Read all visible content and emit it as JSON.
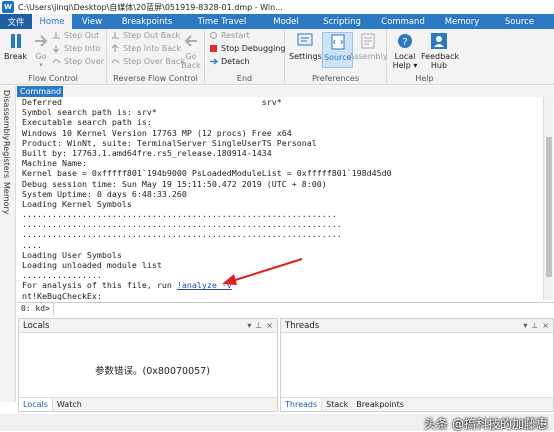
{
  "window": {
    "title": "C:\\Users\\jinqi\\Desktop\\自媒体\\20蓝屏\\051919-8328-01.dmp - Win..."
  },
  "ribbon": {
    "tabs": [
      "文件",
      "Home",
      "View",
      "Breakpoints",
      "Time Travel",
      "Model",
      "Scripting",
      "Command",
      "Memory",
      "Source"
    ],
    "active_tab": "Home",
    "flow_control": {
      "label": "Flow Control",
      "break": "Break",
      "go": "Go",
      "step_out": "Step Out",
      "step_into": "Step Into",
      "step_over": "Step Over"
    },
    "reverse_flow": {
      "label": "Reverse Flow Control",
      "step_out_back": "Step Out Back",
      "step_into_back": "Step Into Back",
      "step_over_back": "Step Over Back",
      "go_back": "Go Back"
    },
    "end": {
      "label": "End",
      "restart": "Restart",
      "stop_debugging": "Stop Debugging",
      "detach": "Detach"
    },
    "preferences": {
      "label": "Preferences",
      "settings": "Settings",
      "source": "Source",
      "assembly": "Assembly"
    },
    "help": {
      "label": "Help",
      "local_help": "Local Help ▾",
      "feedback_hub": "Feedback Hub"
    }
  },
  "command_window": {
    "tab_label": "Command",
    "side_tabs": [
      "Disassembly",
      "Registers",
      "Memory"
    ],
    "lines": [
      "Deferred                                        srv*",
      "Symbol search path is: srv*",
      "Executable search path is:",
      "Windows 10 Kernel Version 17763 MP (12 procs) Free x64",
      "Product: WinNt, suite: TerminalServer SingleUserTS Personal",
      "Built by: 17763.1.amd64fre.rs5_release.180914-1434",
      "Machine Name:",
      "Kernel base = 0xfffff801`194b9000 PsLoadedModuleList = 0xfffff801`198d45d0",
      "Debug session time: Sun May 19 15:11:50.472 2019 (UTC + 8:00)",
      "System Uptime: 0 days 6:48:33.260",
      "Loading Kernel Symbols",
      "...............................................................",
      "................................................................",
      "................................................................",
      "....",
      "Loading User Symbols",
      "Loading unloaded module list",
      "................",
      "nt!KeBugCheckEx:"
    ],
    "analyze_prefix": "For analysis of this file, run ",
    "analyze_link": "!analyze -v",
    "prompt": "0: kd>",
    "input_value": ""
  },
  "locals_pane": {
    "title": "Locals",
    "message": "参数错误。(0x80070057)",
    "tabs": [
      "Locals",
      "Watch"
    ]
  },
  "threads_pane": {
    "title": "Threads",
    "tabs": [
      "Threads",
      "Stack",
      "Breakpoints"
    ]
  },
  "watermark": "头条 @搞科技的加藤惠",
  "colors": {
    "ribbon_blue": "#2b79c2",
    "annotation_arrow": "#e02020",
    "link_blue": "#1a4fa8"
  }
}
